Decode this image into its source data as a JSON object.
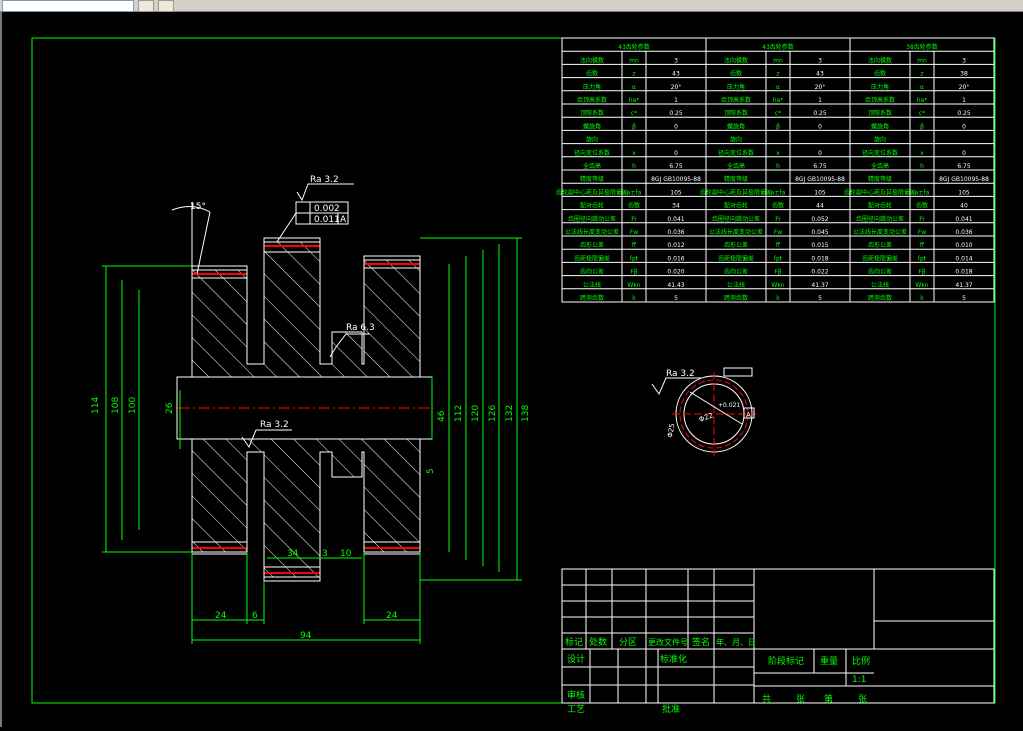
{
  "toolbar": {
    "icons": [
      "cad-tool-icon",
      "layer-icon"
    ]
  },
  "drawing": {
    "dims_left": [
      "114",
      "108",
      "100",
      "26"
    ],
    "dims_right": [
      "46",
      "112",
      "120",
      "126",
      "132",
      "138"
    ],
    "dims_bottom": {
      "a": "24",
      "b": "6",
      "c": "24",
      "d": "94",
      "e": "34",
      "f": "3",
      "g": "10",
      "h": "5"
    },
    "angle": "15°",
    "roughness1": "Ra 3.2",
    "roughness2": "Ra 3.2",
    "roughness3": "Ra 6.3",
    "roughness4": "Ra 3.2",
    "tol1": "0.002",
    "tol2": "0.011",
    "datum": "A",
    "detail_dia1": "Φ25",
    "detail_dia2": "Φ22",
    "detail_tol": "+0.021"
  },
  "param_table": {
    "headers": [
      "43齿轮参数",
      "43齿轮参数",
      "38齿轮参数"
    ],
    "rows": [
      [
        "法向模数",
        "mn",
        "3",
        "法向模数",
        "mn",
        "3",
        "法向模数",
        "mn",
        "3"
      ],
      [
        "齿数",
        "z",
        "43",
        "齿数",
        "z",
        "43",
        "齿数",
        "z",
        "38"
      ],
      [
        "压力角",
        "α",
        "20°",
        "压力角",
        "α",
        "20°",
        "压力角",
        "α",
        "20°"
      ],
      [
        "齿顶高系数",
        "ha*",
        "1",
        "齿顶高系数",
        "ha*",
        "1",
        "齿顶高系数",
        "ha*",
        "1"
      ],
      [
        "顶隙系数",
        "c*",
        "0.25",
        "顶隙系数",
        "c*",
        "0.25",
        "顶隙系数",
        "c*",
        "0.25"
      ],
      [
        "螺旋角",
        "β",
        "0",
        "螺旋角",
        "β",
        "0",
        "螺旋角",
        "β",
        "0"
      ],
      [
        "旋向",
        "",
        "",
        "旋向",
        "",
        "",
        "旋向",
        "",
        ""
      ],
      [
        "径向变位系数",
        "x",
        "0",
        "径向变位系数",
        "x",
        "0",
        "径向变位系数",
        "x",
        "0"
      ],
      [
        "全齿高",
        "h",
        "6.75",
        "全齿高",
        "h",
        "6.75",
        "全齿高",
        "h",
        "6.75"
      ],
      [
        "精度等级",
        "",
        "8GJ GB10095-88",
        "精度等级",
        "",
        "8GJ GB10095-88",
        "精度等级",
        "",
        "8GJ GB10095-88"
      ],
      [
        "齿轮副中心距及其极限偏差",
        "a±fa",
        "105",
        "齿轮副中心距及其极限偏差",
        "a±fa",
        "105",
        "齿轮副中心距及其极限偏差",
        "a±fa",
        "105"
      ],
      [
        "配对齿轮",
        "齿数",
        "34",
        "配对齿轮",
        "齿数",
        "44",
        "配对齿轮",
        "齿数",
        "40"
      ],
      [
        "齿圈径向跳动公差",
        "Fr",
        "0.041",
        "齿圈径向跳动公差",
        "Fr",
        "0.052",
        "齿圈径向跳动公差",
        "Fr",
        "0.041"
      ],
      [
        "公法线长度变动公差",
        "Fw",
        "0.036",
        "公法线长度变动公差",
        "Fw",
        "0.045",
        "公法线长度变动公差",
        "Fw",
        "0.036"
      ],
      [
        "齿形公差",
        "ff",
        "0.012",
        "齿形公差",
        "ff",
        "0.015",
        "齿形公差",
        "ff",
        "0.010"
      ],
      [
        "齿距极限偏差",
        "fpt",
        "0.016",
        "齿距极限偏差",
        "fpt",
        "0.018",
        "齿距极限偏差",
        "fpt",
        "0.014"
      ],
      [
        "齿向公差",
        "Fβ",
        "0.020",
        "齿向公差",
        "Fβ",
        "0.022",
        "齿向公差",
        "Fβ",
        "0.018"
      ],
      [
        "公法线",
        "Wkn",
        "41.43",
        "公法线",
        "Wkn",
        "41.37",
        "公法线",
        "Wkn",
        "41.37"
      ],
      [
        "跨测齿数",
        "k",
        "5",
        "跨测齿数",
        "k",
        "5",
        "跨测齿数",
        "k",
        "5"
      ]
    ]
  },
  "title_block": {
    "row_labels": [
      "标记",
      "处数",
      "分区",
      "更改文件号",
      "签名",
      "年、月、日"
    ],
    "design": "设计",
    "standard": "标准化",
    "review": "审核",
    "process": "工艺",
    "approve": "批准",
    "stage": "阶段标记",
    "weight": "重量",
    "scale_label": "比例",
    "scale": "1:1",
    "sheets": "共",
    "sheet_label": "张",
    "page": "第",
    "page_label": "张"
  },
  "colors": {
    "border": "#00ff00",
    "outline": "#ffffff",
    "center": "#ff0000"
  }
}
